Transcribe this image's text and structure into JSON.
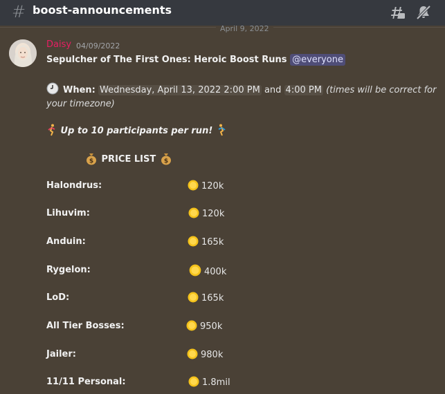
{
  "header": {
    "channel_name": "boost-announcements",
    "hash_icon": "hash-icon",
    "threads_icon": "threads-icon",
    "mute_icon": "bell-slash-icon"
  },
  "divider": {
    "date": "April 9, 2022"
  },
  "message": {
    "author": "Daisy",
    "author_color": "#e91e63",
    "timestamp": "04/09/2022",
    "title": "Sepulcher of The First Ones: Heroic Boost Runs",
    "mention": "@everyone",
    "when_label": "When:",
    "when_time_1": "Wednesday, April 13, 2022 2:00 PM",
    "when_and": "and",
    "when_time_2": "4:00 PM",
    "when_note": "(times will be correct for your timezone)",
    "participants": "Up to 10 participants per run!",
    "price_list_title": "PRICE LIST",
    "prices": [
      {
        "label": "Halondrus:",
        "value": "120k"
      },
      {
        "label": "Lihuvim:",
        "value": "120k"
      },
      {
        "label": "Anduin:",
        "value": "165k"
      },
      {
        "label": "Rygelon:",
        "value": "400k"
      },
      {
        "label": "LoD:",
        "value": "165k"
      },
      {
        "label": "All Tier Bosses:",
        "value": "950k"
      },
      {
        "label": "Jailer:",
        "value": "980k"
      },
      {
        "label": "11/11 Personal:",
        "value": "1.8mil"
      }
    ]
  }
}
